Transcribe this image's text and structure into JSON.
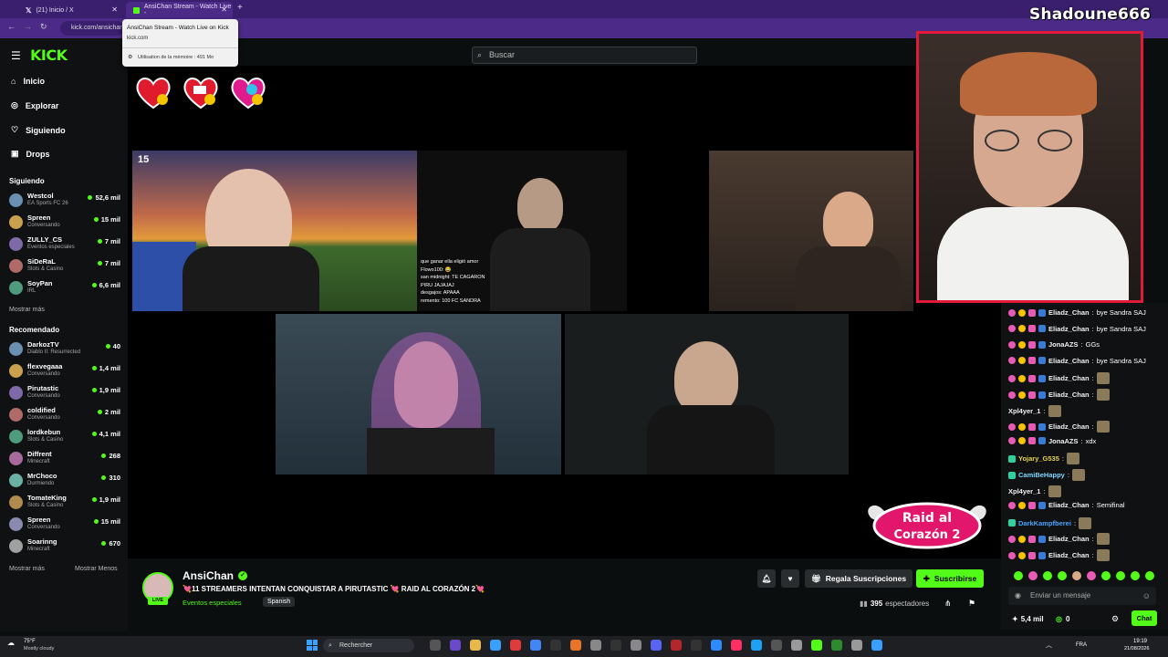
{
  "browser": {
    "tabs": [
      {
        "label": "(21) Inicio / X"
      },
      {
        "label": "AnsiChan Stream - Watch Live -"
      }
    ],
    "url": "kick.com/ansichan",
    "tooltip": {
      "title": "AnsiChan Stream - Watch Live on Kick",
      "domain": "kick.com",
      "memory": "Utilisation de la mémoire : 491 Mo"
    }
  },
  "header": {
    "search_placeholder": "Buscar"
  },
  "nav": [
    {
      "label": "Inicio",
      "icon": "home-icon"
    },
    {
      "label": "Explorar",
      "icon": "compass-icon"
    },
    {
      "label": "Siguiendo",
      "icon": "heart-icon"
    },
    {
      "label": "Drops",
      "icon": "gift-icon"
    }
  ],
  "following": {
    "title": "Siguiendo",
    "more": "Mostrar más",
    "channels": [
      {
        "name": "Westcol",
        "category": "EA Sports FC 26",
        "viewers": "52,6 mil"
      },
      {
        "name": "Spreen",
        "category": "Conversando",
        "viewers": "15 mil"
      },
      {
        "name": "ZULLY_CS",
        "category": "Eventos especiales",
        "viewers": "7 mil"
      },
      {
        "name": "SiDeRaL",
        "category": "Slots & Casino",
        "viewers": "7 mil"
      },
      {
        "name": "SoyPan",
        "category": "IRL",
        "viewers": "6,6 mil"
      }
    ]
  },
  "recommended": {
    "title": "Recomendado",
    "more": "Mostrar más",
    "less": "Mostrar Menos",
    "channels": [
      {
        "name": "DarkozTV",
        "category": "Diablo II: Resurrected",
        "viewers": "40"
      },
      {
        "name": "flexvegaaa",
        "category": "Conversando",
        "viewers": "1,4 mil"
      },
      {
        "name": "Pirutastic",
        "category": "Conversando",
        "viewers": "1,9 mil"
      },
      {
        "name": "coldified",
        "category": "Conversando",
        "viewers": "2 mil"
      },
      {
        "name": "lordkebun",
        "category": "Slots & Casino",
        "viewers": "4,1 mil"
      },
      {
        "name": "Diffrent",
        "category": "Minecraft",
        "viewers": "268"
      },
      {
        "name": "MrChoco",
        "category": "Durmiendo",
        "viewers": "310"
      },
      {
        "name": "TomateKing",
        "category": "Slots & Casino",
        "viewers": "1,9 mil"
      },
      {
        "name": "Spreen",
        "category": "Conversando",
        "viewers": "15 mil"
      },
      {
        "name": "Soarinng",
        "category": "Minecraft",
        "viewers": "670"
      }
    ]
  },
  "overlay": {
    "streamer_name": "Shadoune666",
    "raid_line1": "Raid al",
    "raid_line2": "Corazón 2",
    "timer": "15"
  },
  "video_chat": [
    "que ganar ella eligió amor",
    "Flowo100: 😂",
    "san midnight: TE CAGARON",
    "PIRU JAJAJAJ",
    "desgajos: APAAA",
    "remento: 100 FC SANDRA"
  ],
  "chat": {
    "messages": [
      {
        "user": "Eliadz_Chan",
        "text": "bye Sandra SAJ",
        "badges": true,
        "user_color": "#f1f1f1"
      },
      {
        "user": "Eliadz_Chan",
        "text": "bye Sandra SAJ",
        "badges": true,
        "user_color": "#f1f1f1"
      },
      {
        "user": "JonaAZS",
        "text": "GGs",
        "badges": true,
        "user_color": "#f1f1f1"
      },
      {
        "user": "Eliadz_Chan",
        "text": "bye Sandra SAJ",
        "badges": true,
        "user_color": "#f1f1f1"
      },
      {
        "user": "Eliadz_Chan",
        "text": "",
        "badges": true,
        "emote": true,
        "user_color": "#f1f1f1"
      },
      {
        "user": "Eliadz_Chan",
        "text": "",
        "badges": true,
        "emote": true,
        "user_color": "#f1f1f1"
      },
      {
        "user": "Xpl4yer_1",
        "text": "",
        "badges": false,
        "emote": true,
        "user_color": "#f1f1f1"
      },
      {
        "user": "Eliadz_Chan",
        "text": "",
        "badges": true,
        "emote": true,
        "user_color": "#f1f1f1"
      },
      {
        "user": "JonaAZS",
        "text": "xdx",
        "badges": true,
        "user_color": "#f1f1f1"
      },
      {
        "user": "Yojary_G535",
        "text": "",
        "badges": false,
        "mod": true,
        "emote": true,
        "user_color": "#e8d24a"
      },
      {
        "user": "CamiBeHappy",
        "text": "",
        "badges": false,
        "mod": true,
        "emote": true,
        "user_color": "#7fd7ff"
      },
      {
        "user": "Xpl4yer_1",
        "text": "",
        "badges": false,
        "emote": true,
        "user_color": "#f1f1f1"
      },
      {
        "user": "Eliadz_Chan",
        "text": "Semifinal",
        "badges": true,
        "user_color": "#f1f1f1"
      },
      {
        "user": "DarkKampfberei",
        "text": "",
        "badges": false,
        "mod": true,
        "emote": true,
        "user_color": "#4aa3ff"
      },
      {
        "user": "Eliadz_Chan",
        "text": "",
        "badges": true,
        "emote": true,
        "user_color": "#f1f1f1"
      },
      {
        "user": "Eliadz_Chan",
        "text": "",
        "badges": true,
        "emote": true,
        "user_color": "#f1f1f1"
      }
    ],
    "input_placeholder": "Enviar un mensaje",
    "points": "5,4 mil",
    "kicks": "0",
    "chat_button": "Chat"
  },
  "stream": {
    "channel": "AnsiChan",
    "live_label": "LIVE",
    "title": "💘11 STREAMERS INTENTAN CONQUISTAR A PIRUTASTIC 💘 RAID AL CORAZÓN 2💘",
    "category": "Eventos especiales",
    "language": "Spanish",
    "viewers": "395",
    "viewers_label": "espectadores",
    "gift_button": "Regala Suscripciones",
    "subscribe_button": "Suscribirse"
  },
  "taskbar": {
    "weather_temp": "75°F",
    "weather_desc": "Mostly cloudy",
    "search_label": "Rechercher",
    "lang": "FRA",
    "time": "19:19",
    "date": "21/08/2026"
  },
  "colors": {
    "kick_green": "#53fc18",
    "browser_purple": "#4c2b88",
    "facecam_border": "#e11a3a"
  }
}
